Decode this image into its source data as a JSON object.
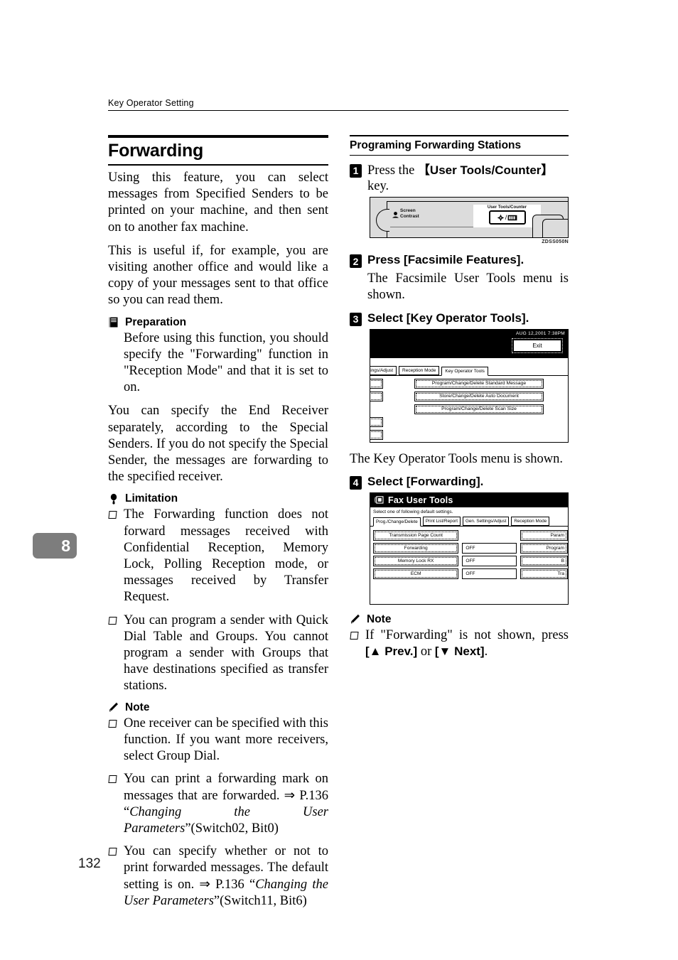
{
  "running_head": "Key Operator Setting",
  "chapter_tab": "8",
  "page_number": "132",
  "left_column": {
    "heading": "Forwarding",
    "intro_1": "Using this feature, you can select messages from Specified Senders to be printed on your machine, and then sent on to another fax machine.",
    "intro_2": "This is useful if, for example, you are visiting another office and would like a copy of your messages sent to that office so you can read them.",
    "preparation": {
      "label": "Preparation",
      "icon": "book-icon",
      "text": "Before using this function, you should specify the \"Forwarding\" function in \"Reception Mode\" and that it is set to on."
    },
    "intro_3": "You can specify the End Receiver separately, according to the Special Senders. If you do not specify the Special Sender, the messages are forwarding to the specified receiver.",
    "limitation": {
      "label": "Limitation",
      "icon": "balloon-pin-icon",
      "items": [
        "The Forwarding function does not forward messages received with Confidential Reception, Memory Lock, Polling Reception mode, or messages received by Transfer Request.",
        "You can program a sender with Quick Dial Table and Groups. You cannot program a sender with Groups that have destinations specified as transfer stations."
      ]
    },
    "note": {
      "label": "Note",
      "icon": "pencil-icon",
      "items": [
        {
          "plain_1": "One receiver can be specified with this function. If you want more receivers, select Group Dial.",
          "italic": "",
          "plain_2": ""
        },
        {
          "plain_1": "You can print a forwarding mark on messages that are forwarded. ⇒ P.136 “",
          "italic": "Changing the User Parameters",
          "plain_2": "”(Switch02, Bit0)"
        },
        {
          "plain_1": "You can specify whether or not to print forwarded messages. The default setting is on. ⇒ P.136 “",
          "italic": "Changing the User Parameters",
          "plain_2": "”(Switch11, Bit6)"
        }
      ]
    }
  },
  "right_column": {
    "heading": "Programing Forwarding Stations",
    "step1": {
      "num": "1",
      "text_pre": "Press the ",
      "text_key": "【User Tools/Counter】",
      "text_post": " key."
    },
    "panel_figure": {
      "contrast_label_line1": "Screen",
      "contrast_label_line2": "Contrast",
      "contrast_icon": "contrast-dial-icon",
      "user_tools_label": "User Tools/Counter",
      "user_tools_key_icon": "user-tools-counter-key-icon",
      "caption": "ZDSS050N"
    },
    "step2": {
      "num": "2",
      "text": "Press [Facsimile Features].",
      "sub": "The Facsimile User Tools menu is shown."
    },
    "step3": {
      "num": "3",
      "text": "Select [Key Operator Tools].",
      "sub": "The Key Operator Tools menu is shown."
    },
    "lcd_key_operator": {
      "datetime": "AUG  12,2001  7:38PM",
      "exit_label": "Exit",
      "tabs": [
        {
          "label": "ettings/Adjust",
          "active": false
        },
        {
          "label": "Reception Mode",
          "active": false
        },
        {
          "label": "Key Operator Tools",
          "active": true
        }
      ],
      "buttons": [
        "Program/Change/Delete Standard Message",
        "Store/Change/Delete Auto Document",
        "Program/Change/Delete Scan Size"
      ],
      "left_stubs": 5
    },
    "step4": {
      "num": "4",
      "text": "Select [Forwarding]."
    },
    "lcd_fax_user_tools": {
      "title": "Fax User Tools",
      "title_icon": "fax-user-tools-icon",
      "subtitle": "Select one of following default settings.",
      "tabs": [
        {
          "label": "Prog./Change/Delete",
          "active": true
        },
        {
          "label": "Print List/Report",
          "active": false
        },
        {
          "label": "Gen. Settings/Adjust",
          "active": false
        },
        {
          "label": "Reception Mode",
          "active": false
        }
      ],
      "rows": [
        {
          "name": "Transmission Page Count",
          "value": "",
          "right": "Param"
        },
        {
          "name": "Forwarding",
          "value": "OFF",
          "right": "Program"
        },
        {
          "name": "Memory Lock RX",
          "value": "OFF",
          "right": "B"
        },
        {
          "name": "ECM",
          "value": "OFF",
          "right": "Tra"
        }
      ]
    },
    "note": {
      "label": "Note",
      "icon": "pencil-icon",
      "item_pre": "If \"Forwarding\" is not shown, press ",
      "item_key1": "[▲ Prev.]",
      "item_mid": " or ",
      "item_key2": "[▼ Next]",
      "item_post": "."
    }
  }
}
